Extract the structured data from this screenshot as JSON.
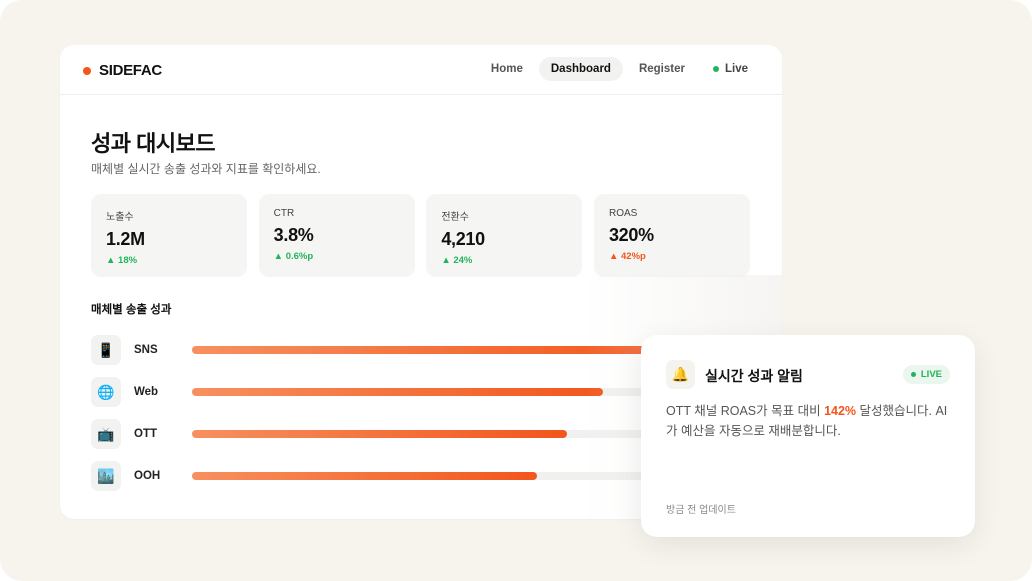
{
  "brand": {
    "name": "SIDEFAC",
    "dot_color": "#f2561c"
  },
  "nav": {
    "items": [
      {
        "label": "Home",
        "active": false
      },
      {
        "label": "Dashboard",
        "active": true
      },
      {
        "label": "Register",
        "active": false
      }
    ],
    "live_label": "Live"
  },
  "page": {
    "title": "성과 대시보드",
    "subtitle": "매체별 실시간 송출 성과와 지표를 확인하세요."
  },
  "stats": [
    {
      "label": "노출수",
      "value": "1.2M",
      "delta": "▲ 18%",
      "delta_color": "#22b45a"
    },
    {
      "label": "CTR",
      "value": "3.8%",
      "delta": "▲ 0.6%p",
      "delta_color": "#22b45a"
    },
    {
      "label": "전환수",
      "value": "4,210",
      "delta": "▲ 24%",
      "delta_color": "#22b45a"
    },
    {
      "label": "ROAS",
      "value": "320%",
      "delta": "▲ 42%p",
      "delta_color": "#f2561c"
    }
  ],
  "channels": {
    "title": "매체별 송출 성과",
    "items": [
      {
        "icon": "mobile-phone-icon",
        "glyph": "📱",
        "label": "SNS",
        "fraction": 0.85
      },
      {
        "icon": "globe-icon",
        "glyph": "🌐",
        "label": "Web",
        "fraction": 0.735
      },
      {
        "icon": "tv-icon",
        "glyph": "📺",
        "label": "OTT",
        "fraction": 0.67
      },
      {
        "icon": "city-icon",
        "glyph": "🏙️",
        "label": "OOH",
        "fraction": 0.617
      }
    ]
  },
  "notification": {
    "icon": "bell-icon",
    "glyph": "🔔",
    "title": "실시간 성과 알림",
    "badge": "LIVE",
    "body_prefix": "OTT 채널 ROAS가 목표 대비 ",
    "body_highlight": "142%",
    "body_suffix": " 달성했습니다. AI가 예산을 자동으로 재배분합니다.",
    "time": "방금 전 업데이트"
  },
  "colors": {
    "accent": "#f2561c",
    "live": "#22b45a",
    "background": "#f7f4ee"
  }
}
